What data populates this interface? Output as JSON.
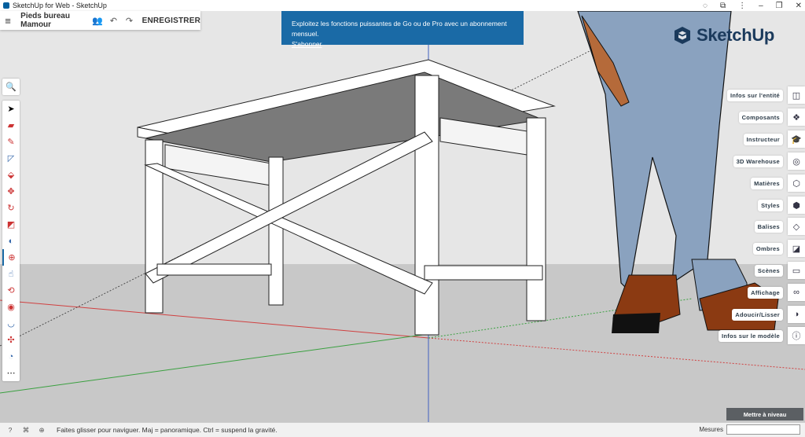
{
  "window": {
    "title": "SketchUp for Web - SketchUp",
    "controls": [
      "eye-off",
      "share",
      "extension",
      "minimize",
      "restore",
      "close"
    ]
  },
  "document": {
    "name": "Pieds bureau Mamour",
    "save_label": "ENREGISTRER"
  },
  "banner": {
    "message": "Exploitez les fonctions puissantes de Go ou de Pro avec un abonnement mensuel.",
    "link": "S'abonner"
  },
  "brand": {
    "name": "SketchUp",
    "color": "#1b3a5c"
  },
  "left_tools": [
    "search",
    "select",
    "eraser",
    "pencil",
    "tape",
    "push-pull",
    "move",
    "rotate",
    "scale",
    "paint",
    "section",
    "orbit",
    "paint-bucket",
    "follow-me",
    "offset",
    "protractor",
    "more"
  ],
  "right_panels": [
    {
      "label": "Infos sur l'entité",
      "icon": "info-entity"
    },
    {
      "label": "Composants",
      "icon": "components"
    },
    {
      "label": "Instructeur",
      "icon": "instructor"
    },
    {
      "label": "3D Warehouse",
      "icon": "warehouse"
    },
    {
      "label": "Matières",
      "icon": "materials"
    },
    {
      "label": "Styles",
      "icon": "styles"
    },
    {
      "label": "Balises",
      "icon": "tags"
    },
    {
      "label": "Ombres",
      "icon": "shadows"
    },
    {
      "label": "Scènes",
      "icon": "scenes"
    },
    {
      "label": "Affichage",
      "icon": "display"
    },
    {
      "label": "Adoucir/Lisser",
      "icon": "soften"
    },
    {
      "label": "Infos sur le modèle",
      "icon": "model-info"
    }
  ],
  "level_button": "Mettre à niveau",
  "status": {
    "hint": "Faites glisser pour naviguer. Maj = panoramique. Ctrl = suspend la gravité.",
    "measures_label": "Mesures",
    "measures_value": ""
  },
  "colors": {
    "accent": "#1a6aa6",
    "axis_red": "#d04040",
    "axis_green": "#3aa040",
    "axis_blue": "#4060c0"
  }
}
